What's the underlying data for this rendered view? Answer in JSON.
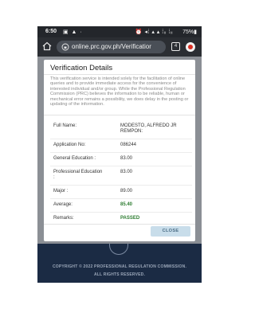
{
  "status_bar": {
    "time": "6:50",
    "left_icons": "▣ ▲ · ",
    "right_icons": "⏰ ◂⁞ ▴ ▴ ⁞ᵢᵢ ⁞ᵢᵢ",
    "battery": "75%▮"
  },
  "browser": {
    "url": "online.prc.gov.ph/Verificatior",
    "tab_count": "4"
  },
  "modal": {
    "title": "Verification Details",
    "notice": "This verification service is intended solely for the facilitation of online queries and to provide immediate access for the convenience of interested individual and/or group. While the Professional Regulation Commission (PRC) believes the information to be reliable, human or mechanical error remains a possibility, we does delay in the posting or updating of the information.",
    "rows": [
      {
        "label": "Full Name:",
        "value": "MODESTO, ALFREDO JR REMPON:"
      },
      {
        "label": "Application No:",
        "value": "086244"
      },
      {
        "label": "General Education :",
        "value": "83.00"
      },
      {
        "label": "Professional Education :",
        "value": "83.00"
      },
      {
        "label": "Major :",
        "value": "89.00"
      },
      {
        "label": "Average:",
        "value": "85.40"
      },
      {
        "label": "Remarks:",
        "value": "PASSED"
      }
    ],
    "close_label": "CLOSE"
  },
  "footer": {
    "line1": "COPYRIGHT © 2022 PROFESSIONAL REGULATION COMMISSION.",
    "line2": "ALL RIGHTS RESERVED."
  },
  "colors": {
    "browser_bar": "#2b2e33",
    "footer_bg": "#1b2b44",
    "passed_green": "#2e7d32",
    "close_button": "#c8ddea"
  }
}
